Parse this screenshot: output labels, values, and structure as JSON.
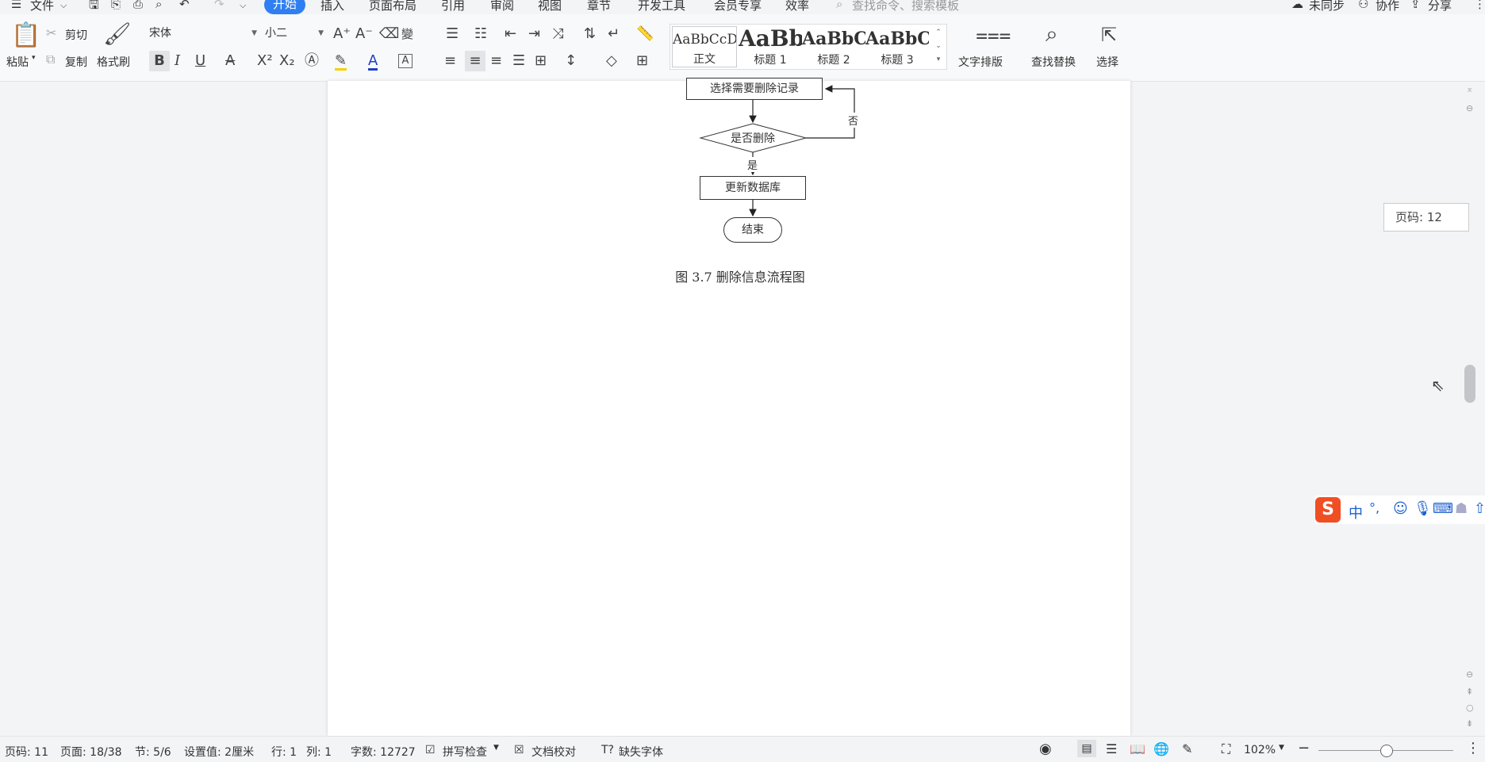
{
  "menubar": {
    "file": "文件",
    "tabs": [
      "开始",
      "插入",
      "页面布局",
      "引用",
      "审阅",
      "视图",
      "章节",
      "开发工具",
      "会员专享",
      "效率"
    ],
    "search_placeholder": "查找命令、搜索模板",
    "sync": "未同步",
    "collab": "协作",
    "share": "分享"
  },
  "ribbon": {
    "paste": "粘贴",
    "cut": "剪切",
    "copy": "复制",
    "format_painter": "格式刷",
    "font_name": "宋体",
    "font_size": "小二",
    "styles": [
      {
        "preview": "AaBbCcDd",
        "name": "正文"
      },
      {
        "preview": "AaBb",
        "name": "标题 1"
      },
      {
        "preview": "AaBbC",
        "name": "标题 2"
      },
      {
        "preview": "AaBbC",
        "name": "标题 3"
      }
    ],
    "text_layout": "文字排版",
    "find_replace": "查找替换",
    "select": "选择"
  },
  "document": {
    "flowchart": {
      "step_select": "选择需要删除记录",
      "decision": "是否删除",
      "no_label": "否",
      "yes_label": "是",
      "step_update": "更新数据库",
      "end": "结束"
    },
    "caption": "图 3.7  删除信息流程图"
  },
  "page_tooltip": "页码: 12",
  "statusbar": {
    "page_num": "页码: 11",
    "pages": "页面: 18/38",
    "section": "节: 5/6",
    "setting": "设置值: 2厘米",
    "row": "行: 1",
    "col": "列: 1",
    "word_count": "字数: 12727",
    "spell_check": "拼写检查",
    "proofread": "文档校对",
    "missing_font": "缺失字体",
    "zoom": "102%"
  },
  "ime": {
    "lang": "中",
    "punct": "°,"
  },
  "colors": {
    "accent": "#2f7ff2",
    "ime_logo": "#f04e23"
  }
}
